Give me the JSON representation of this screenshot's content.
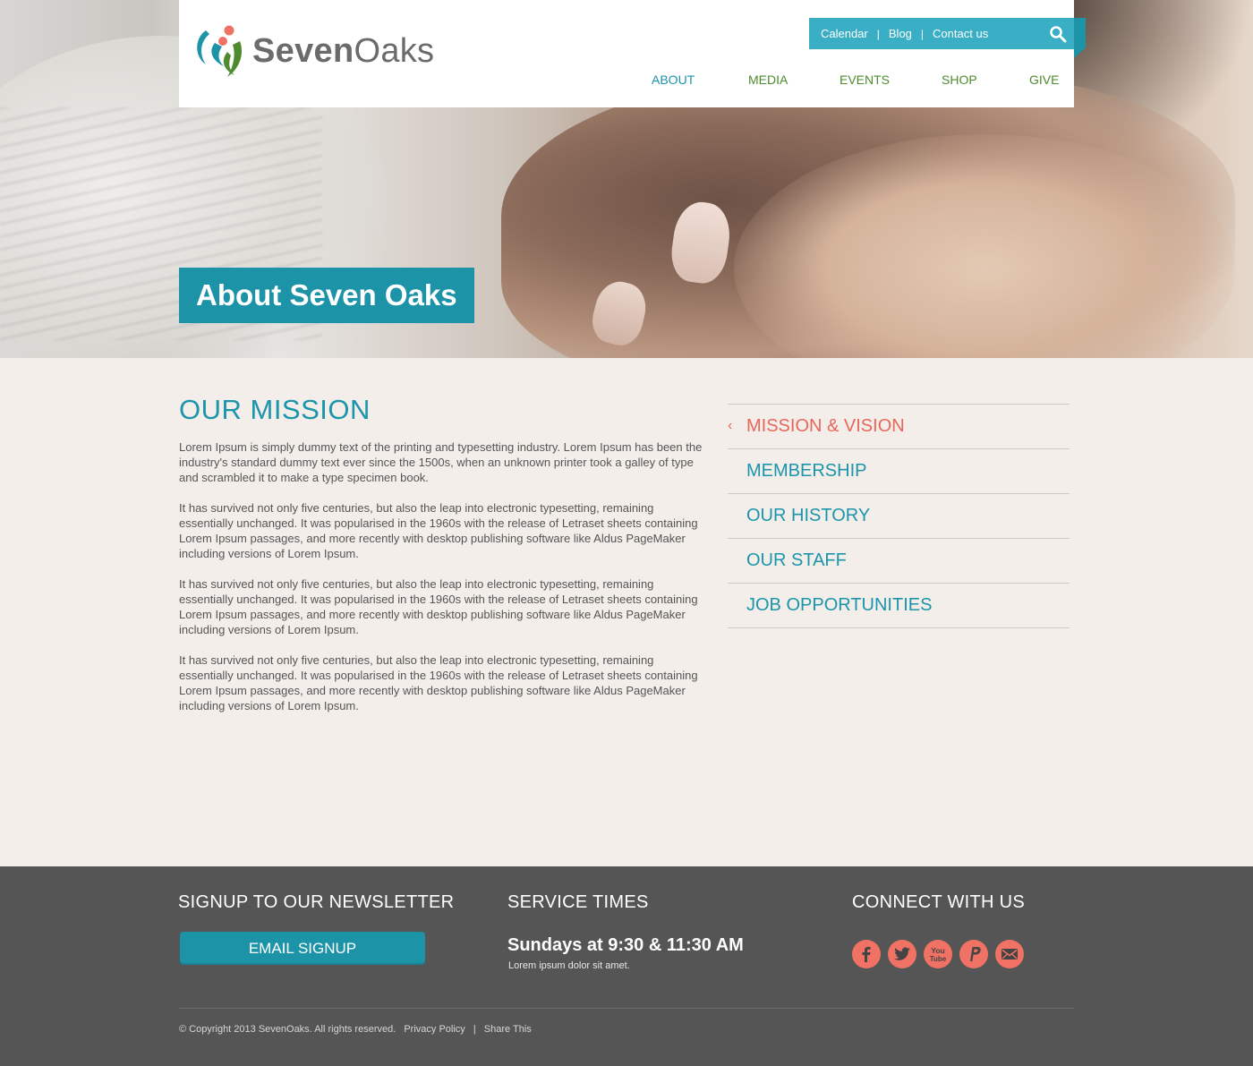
{
  "header": {
    "brand_bold": "Seven",
    "brand_light": "Oaks",
    "utility_links": [
      "Calendar",
      "Blog",
      "Contact us"
    ],
    "utility_sep": "|",
    "nav": [
      "ABOUT",
      "MEDIA",
      "EVENTS",
      "SHOP",
      "GIVE"
    ]
  },
  "hero": {
    "title": "About Seven Oaks"
  },
  "main": {
    "heading": "OUR MISSION",
    "paragraphs": [
      "Lorem Ipsum is simply dummy text of the printing and typesetting industry. Lorem Ipsum has been the industry's standard dummy text ever since the 1500s, when an unknown printer took a galley of type and scrambled it to make a type specimen book.",
      "It has survived not only five centuries, but also the leap into electronic typesetting, remaining essentially unchanged. It was popularised in the 1960s with the release of Letraset sheets containing Lorem Ipsum passages, and more recently with desktop publishing software like Aldus PageMaker including versions of Lorem Ipsum.",
      "It has survived not only five centuries, but also the leap into electronic typesetting, remaining essentially unchanged. It was popularised in the 1960s with the release of Letraset sheets containing Lorem Ipsum passages, and more recently with desktop publishing software like Aldus PageMaker including versions of Lorem Ipsum.",
      "It has survived not only five centuries, but also the leap into electronic typesetting, remaining essentially unchanged. It was popularised in the 1960s with the release of Letraset sheets containing Lorem Ipsum passages, and more recently with desktop publishing software like Aldus PageMaker including versions of Lorem Ipsum."
    ]
  },
  "sidebar": {
    "chevron": "‹",
    "items": [
      "MISSION & VISION",
      "MEMBERSHIP",
      "OUR HISTORY",
      "OUR STAFF",
      "JOB OPPORTUNITIES"
    ]
  },
  "footer": {
    "newsletter_heading": "SIGNUP TO OUR NEWSLETTER",
    "email_button": "EMAIL SIGNUP",
    "service_heading": "SERVICE TIMES",
    "service_time": "Sundays at 9:30 & 11:30 AM",
    "service_sub": "Lorem ipsum dolor sit amet.",
    "connect_heading": "CONNECT WITH US",
    "social_icons": [
      "facebook-icon",
      "twitter-icon",
      "youtube-icon",
      "paypal-icon",
      "email-icon"
    ],
    "copyright": "© Copyright 2013 SevenOaks. All rights reserved.",
    "privacy": "Privacy Policy",
    "sep": "|",
    "share": "Share This"
  },
  "colors": {
    "teal": "#1d93a8",
    "teal_light": "#3aaec5",
    "green": "#4e8a2e",
    "coral": "#e8675a",
    "footer_bg": "#555555",
    "content_bg": "#f3eeea"
  }
}
